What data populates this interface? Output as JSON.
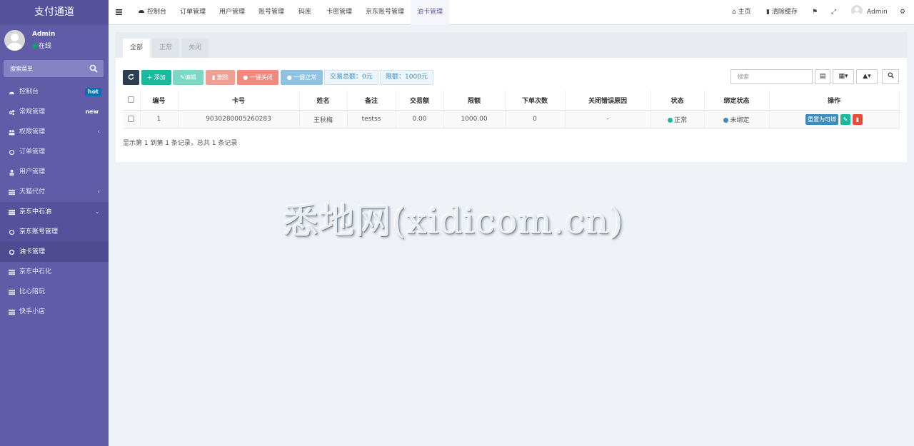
{
  "app": {
    "title": "支付通道"
  },
  "user": {
    "name": "Admin",
    "status": "在线",
    "status_color": "#00a65a"
  },
  "sidebar": {
    "search_placeholder": "搜索菜单",
    "items": [
      {
        "label": "控制台",
        "icon": "dashboard-icon",
        "badge": "hot"
      },
      {
        "label": "常规管理",
        "icon": "cogs-icon",
        "badge": "new"
      },
      {
        "label": "权限管理",
        "icon": "users-icon",
        "arrow": "‹"
      },
      {
        "label": "订单管理",
        "icon": "circle-icon"
      },
      {
        "label": "用户管理",
        "icon": "user-icon"
      },
      {
        "label": "天猫代付",
        "icon": "list-icon",
        "arrow": "‹"
      },
      {
        "label": "京东中石油",
        "icon": "list-icon",
        "arrow": "⌄"
      },
      {
        "label": "京东账号管理",
        "icon": "circle-icon"
      },
      {
        "label": "油卡管理",
        "icon": "circle-icon"
      },
      {
        "label": "京东中石化",
        "icon": "list-icon"
      },
      {
        "label": "比心陪玩",
        "icon": "list-icon"
      },
      {
        "label": "快手小店",
        "icon": "list-icon"
      }
    ]
  },
  "topnav": {
    "tabs": [
      "控制台",
      "订单管理",
      "用户管理",
      "账号管理",
      "码库",
      "卡密管理",
      "京东账号管理",
      "油卡管理"
    ],
    "right": {
      "home": "主页",
      "clear_cache": "清除缓存",
      "admin": "Admin"
    }
  },
  "content": {
    "filter_tabs": [
      "全部",
      "正常",
      "关闭"
    ],
    "toolbar": {
      "add": "添加",
      "edit": "编辑",
      "delete": "删除",
      "close_all": "一键关闭",
      "normal_all": "一键正常",
      "total": "交易总额：0元",
      "limit": "限额：1000元"
    },
    "search_placeholder": "搜索",
    "table": {
      "headers": [
        "编号",
        "卡号",
        "姓名",
        "备注",
        "交易额",
        "限额",
        "下单次数",
        "关闭错误原因",
        "状态",
        "绑定状态",
        "操作"
      ],
      "rows": [
        {
          "id": "1",
          "card_no": "9030280005260283",
          "name": "王秋梅",
          "remark": "testss",
          "amount": "0.00",
          "limit": "1000.00",
          "orders": "0",
          "close_reason": "-",
          "status": "正常",
          "bind_status": "未绑定",
          "reset_label": "重置为可绑"
        }
      ]
    },
    "pagination": "显示第 1 到第 1 条记录，总共 1 条记录"
  },
  "watermark": "悉地网(xidicom.cn)",
  "colors": {
    "sidebar": "#605ca8",
    "primary": "#3c8dbc",
    "success": "#18bc9c",
    "danger": "#e74c3c",
    "dark": "#2c3e50"
  }
}
